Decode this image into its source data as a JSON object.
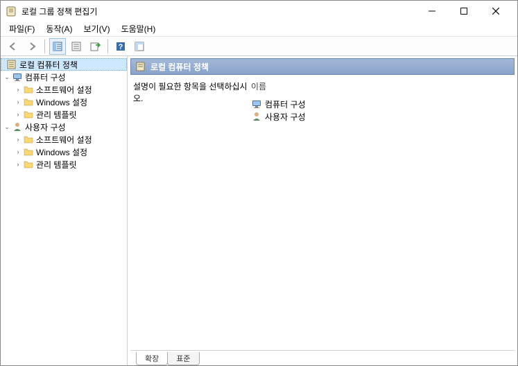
{
  "window": {
    "title": "로컬 그룹 정책 편집기"
  },
  "menu": {
    "file": "파일(F)",
    "action": "동작(A)",
    "view": "보기(V)",
    "help": "도움말(H)"
  },
  "tree": {
    "root": "로컬 컴퓨터 정책",
    "computer": "컴퓨터 구성",
    "comp_software": "소프트웨어 설정",
    "comp_windows": "Windows 설정",
    "comp_admin": "관리 템플릿",
    "user": "사용자 구성",
    "user_software": "소프트웨어 설정",
    "user_windows": "Windows 설정",
    "user_admin": "관리 템플릿"
  },
  "pane": {
    "header": "로컬 컴퓨터 정책",
    "desc": "설명이 필요한 항목을 선택하십시오.",
    "col_name": "이름",
    "items": {
      "computer": "컴퓨터 구성",
      "user": "사용자 구성"
    }
  },
  "tabs": {
    "extended": "확장",
    "standard": "표준"
  }
}
